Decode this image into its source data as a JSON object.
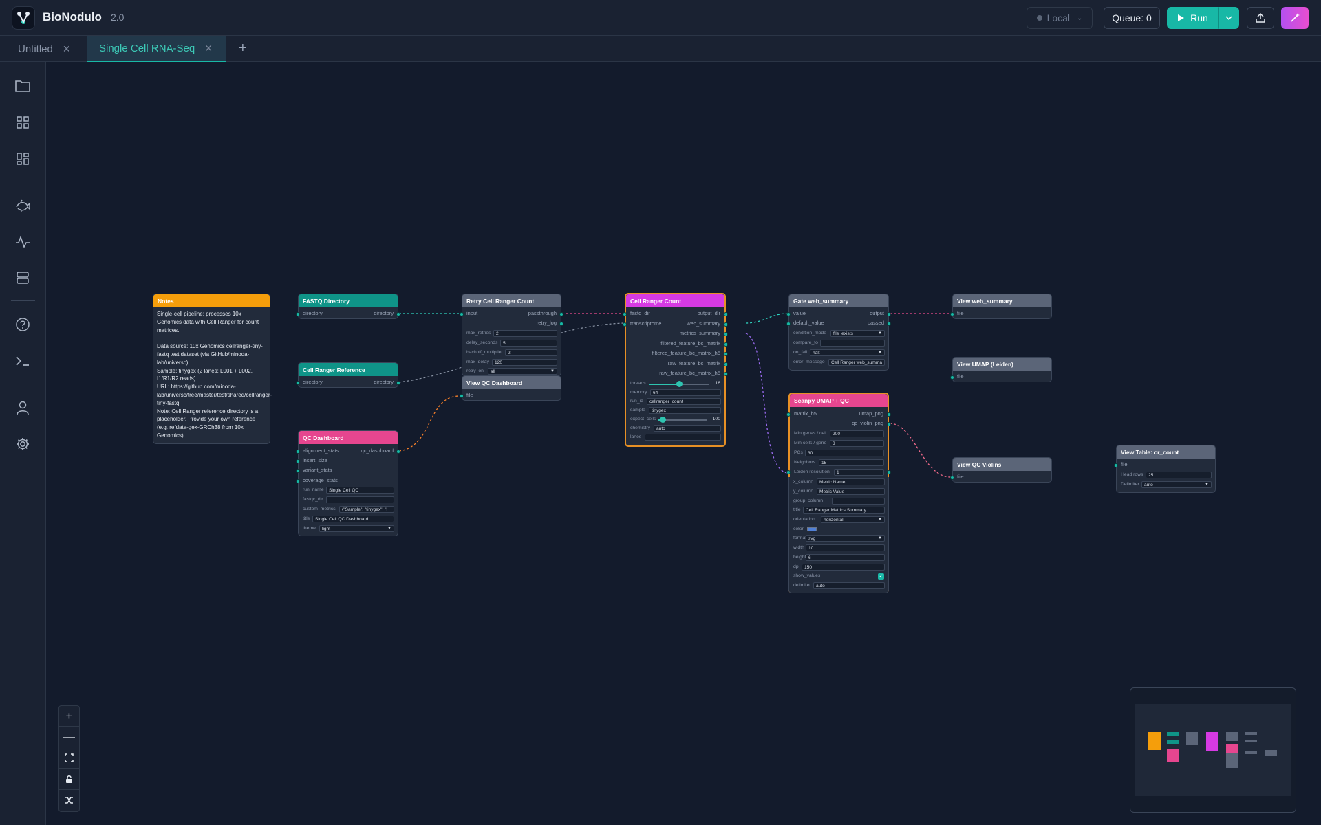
{
  "app": {
    "name": "BioNodulo",
    "version": "2.0"
  },
  "toolbar": {
    "runtime": "Local",
    "queue": "Queue: 0",
    "run": "Run"
  },
  "tabs": [
    {
      "label": "Untitled",
      "active": false
    },
    {
      "label": "Single Cell RNA-Seq",
      "active": true
    }
  ],
  "sidebar": [
    "folder-icon",
    "grid-icon",
    "dashboard-icon",
    "fish-icon",
    "activity-icon",
    "server-icon",
    "help-icon",
    "terminal-icon",
    "user-icon",
    "settings-icon"
  ],
  "colors": {
    "accent": "#18b8a6",
    "notes": "#f59e0b",
    "teal": "#0f9488",
    "pink": "#e6468f",
    "magenta": "#d63ae3",
    "gray": "#5b6578",
    "selected": "#e79025"
  },
  "nodes": {
    "notes": {
      "title": "Notes",
      "body": "Single-cell pipeline: processes 10x Genomics data with Cell Ranger for count matrices.\n\nData source: 10x Genomics cellranger-tiny-fastq test dataset (via GitHub/minoda-lab/universc).\nSample: tinygex (2 lanes: L001 + L002, I1/R1/R2 reads).\nURL: https://github.com/minoda-lab/universc/tree/master/test/shared/cellranger-tiny-fastq\nNote: Cell Ranger reference directory is a placeholder. Provide your own reference (e.g. refdata-gex-GRCh38 from 10x Genomics)."
    },
    "fastq": {
      "title": "FASTQ Directory",
      "in": "directory",
      "out": "directory"
    },
    "reference": {
      "title": "Cell Ranger Reference",
      "in": "directory",
      "out": "directory"
    },
    "qc_dashboard": {
      "title": "QC Dashboard",
      "inputs": [
        "alignment_stats",
        "insert_size",
        "variant_stats",
        "coverage_stats"
      ],
      "output": "qc_dashboard",
      "params": [
        {
          "label": "run_name",
          "value": "Single Cell QC"
        },
        {
          "label": "fastqc_dir",
          "value": ""
        },
        {
          "label": "custom_metrics",
          "value": "{\"Sample\": \"tinygex\", \"l"
        },
        {
          "label": "title",
          "value": "Single Cell QC Dashboard"
        },
        {
          "label": "theme",
          "value": "light"
        }
      ]
    },
    "retry": {
      "title": "Retry Cell Ranger Count",
      "in": "input",
      "outputs": [
        "passthrough",
        "retry_log"
      ],
      "params": [
        {
          "label": "max_retries",
          "value": "2"
        },
        {
          "label": "delay_seconds",
          "value": "5"
        },
        {
          "label": "backoff_multiplier",
          "value": "2"
        },
        {
          "label": "max_delay",
          "value": "120"
        },
        {
          "label": "retry_on",
          "value": "all"
        }
      ]
    },
    "view_qc_dashboard": {
      "title": "View QC Dashboard",
      "in": "file"
    },
    "cellranger": {
      "title": "Cell Ranger Count",
      "inputs": [
        "fastq_dir",
        "transcriptome"
      ],
      "outputs": [
        "output_dir",
        "web_summary",
        "metrics_summary",
        "filtered_feature_bc_matrix",
        "filtered_feature_bc_matrix_h5",
        "raw_feature_bc_matrix",
        "raw_feature_bc_matrix_h5"
      ],
      "threads": {
        "label": "threads",
        "value": 16,
        "max": 32,
        "display": "16"
      },
      "params": [
        {
          "label": "memory",
          "value": "64"
        },
        {
          "label": "run_id",
          "value": "cellranger_count"
        },
        {
          "label": "sample",
          "value": "tinygex"
        }
      ],
      "expect_cells": {
        "label": "expect_cells",
        "value": 100,
        "max": 1000,
        "display": "100"
      },
      "params2": [
        {
          "label": "chemistry",
          "value": "auto"
        },
        {
          "label": "lanes",
          "value": ""
        }
      ]
    },
    "gate": {
      "title": "Gate web_summary",
      "inputs": [
        "value",
        "default_value"
      ],
      "outputs": [
        "output",
        "passed"
      ],
      "params": [
        {
          "label": "condition_mode",
          "value": "file_exists"
        },
        {
          "label": "compare_to",
          "value": ""
        },
        {
          "label": "on_fail",
          "value": "halt"
        },
        {
          "label": "error_message",
          "value": "Cell Ranger web_summa"
        }
      ]
    },
    "scanpy": {
      "title": "Scanpy UMAP + QC",
      "in": "matrix_h5",
      "outputs": [
        "umap_png",
        "qc_violin_png"
      ],
      "params": [
        {
          "label": "Min genes / cell",
          "value": "200"
        },
        {
          "label": "Min cells / gene",
          "value": "3"
        },
        {
          "label": "PCs",
          "value": "30"
        },
        {
          "label": "Neighbors",
          "value": "15"
        },
        {
          "label": "Leiden resolution",
          "value": "1"
        }
      ]
    },
    "plot": {
      "params": [
        {
          "label": "x_column",
          "value": "Metric Name"
        },
        {
          "label": "y_column",
          "value": "Metric Value"
        },
        {
          "label": "group_column",
          "value": ""
        },
        {
          "label": "title",
          "value": "Cell Ranger Metrics Summary"
        },
        {
          "label": "orientation",
          "value": "horizontal"
        }
      ],
      "color_label": "color",
      "color_value": "#4f7fd6",
      "params2": [
        {
          "label": "format",
          "value": "svg"
        },
        {
          "label": "width",
          "value": "10"
        },
        {
          "label": "height",
          "value": "6"
        },
        {
          "label": "dpi",
          "value": "150"
        }
      ],
      "show_values_label": "show_values",
      "show_values": true,
      "delimiter_label": "delimiter",
      "delimiter": "auto"
    },
    "view_web_summary": {
      "title": "View web_summary",
      "in": "file"
    },
    "view_umap": {
      "title": "View UMAP (Leiden)",
      "in": "file"
    },
    "view_qc_violins": {
      "title": "View QC Violins",
      "in": "file"
    },
    "view_table": {
      "title": "View Table: cr_count",
      "in": "file",
      "params": [
        {
          "label": "Head rows",
          "value": "25"
        },
        {
          "label": "Delimiter",
          "value": "auto"
        }
      ]
    }
  }
}
